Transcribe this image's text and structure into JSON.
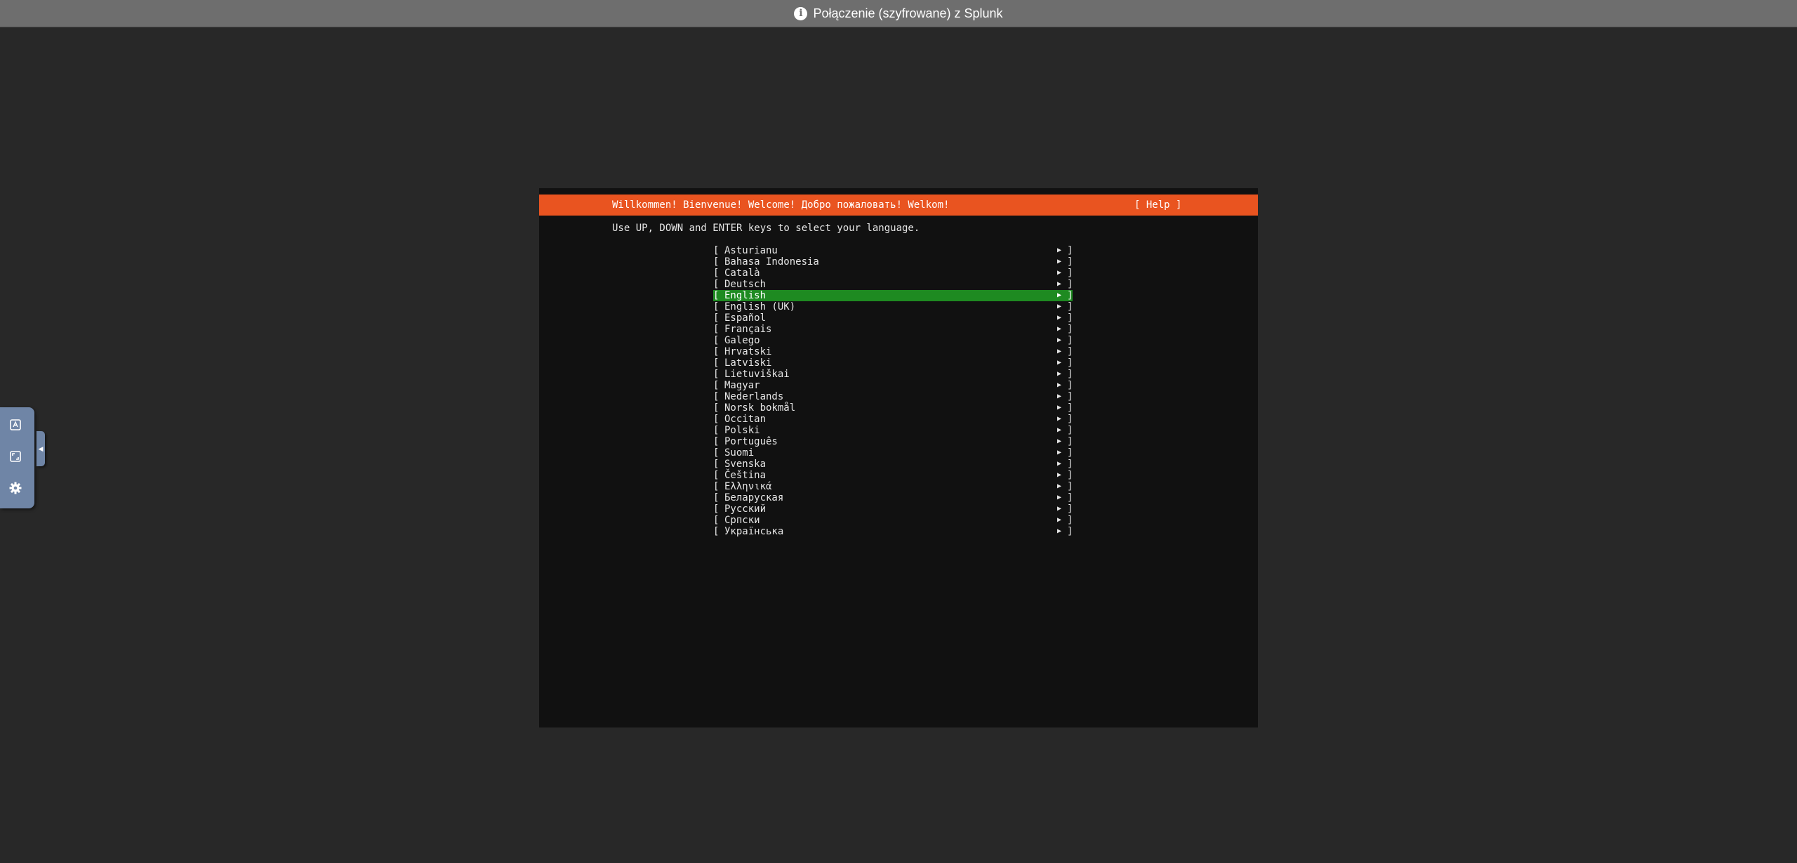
{
  "window": {
    "connection_title": "Połączenie (szyfrowane) z Splunk",
    "info_icon_glyph": "i"
  },
  "toolbar": {
    "items": [
      {
        "name": "keyboard-icon"
      },
      {
        "name": "fullscreen-icon"
      },
      {
        "name": "settings-gear-icon"
      }
    ],
    "accent_color": "#6f85a6"
  },
  "installer": {
    "header_title": "Willkommen! Bienvenue! Welcome! Добро пожаловать! Welkom!",
    "help_label": "[ Help ]",
    "instructions": "Use UP, DOWN and ENTER keys to select your language.",
    "header_color": "#e95420",
    "selected_color": "#1e8a21",
    "selected_index": 4,
    "arrow_glyph": "▶",
    "left_bracket": "[",
    "right_bracket": "]",
    "languages": [
      "Asturianu",
      "Bahasa Indonesia",
      "Català",
      "Deutsch",
      "English",
      "English (UK)",
      "Español",
      "Français",
      "Galego",
      "Hrvatski",
      "Latviski",
      "Lietuviškai",
      "Magyar",
      "Nederlands",
      "Norsk bokmål",
      "Occitan",
      "Polski",
      "Português",
      "Suomi",
      "Svenska",
      "Čeština",
      "Ελληνικά",
      "Беларуская",
      "Русский",
      "Српски",
      "Українська"
    ]
  }
}
